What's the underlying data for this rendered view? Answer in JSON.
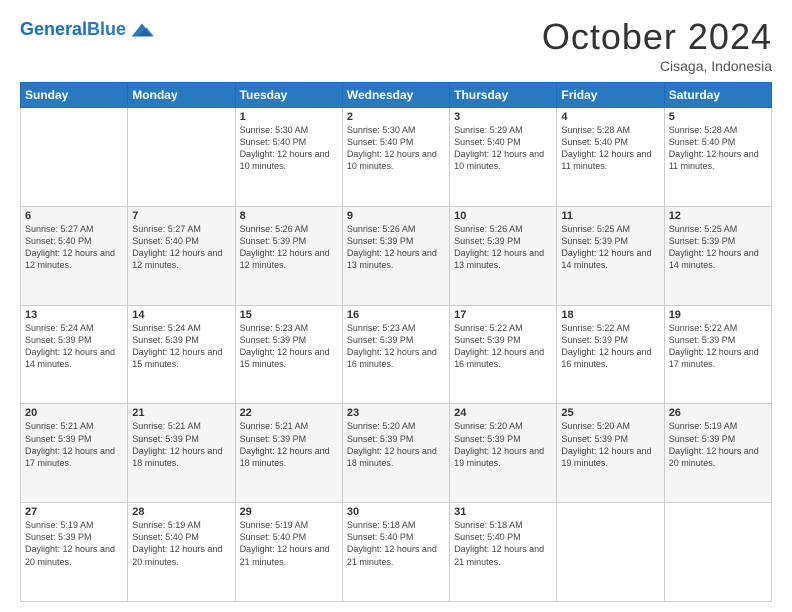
{
  "header": {
    "logo_general": "General",
    "logo_blue": "Blue",
    "month_title": "October 2024",
    "location": "Cisaga, Indonesia"
  },
  "weekdays": [
    "Sunday",
    "Monday",
    "Tuesday",
    "Wednesday",
    "Thursday",
    "Friday",
    "Saturday"
  ],
  "weeks": [
    [
      {
        "day": "",
        "info": ""
      },
      {
        "day": "",
        "info": ""
      },
      {
        "day": "1",
        "info": "Sunrise: 5:30 AM\nSunset: 5:40 PM\nDaylight: 12 hours and 10 minutes."
      },
      {
        "day": "2",
        "info": "Sunrise: 5:30 AM\nSunset: 5:40 PM\nDaylight: 12 hours and 10 minutes."
      },
      {
        "day": "3",
        "info": "Sunrise: 5:29 AM\nSunset: 5:40 PM\nDaylight: 12 hours and 10 minutes."
      },
      {
        "day": "4",
        "info": "Sunrise: 5:28 AM\nSunset: 5:40 PM\nDaylight: 12 hours and 11 minutes."
      },
      {
        "day": "5",
        "info": "Sunrise: 5:28 AM\nSunset: 5:40 PM\nDaylight: 12 hours and 11 minutes."
      }
    ],
    [
      {
        "day": "6",
        "info": "Sunrise: 5:27 AM\nSunset: 5:40 PM\nDaylight: 12 hours and 12 minutes."
      },
      {
        "day": "7",
        "info": "Sunrise: 5:27 AM\nSunset: 5:40 PM\nDaylight: 12 hours and 12 minutes."
      },
      {
        "day": "8",
        "info": "Sunrise: 5:26 AM\nSunset: 5:39 PM\nDaylight: 12 hours and 12 minutes."
      },
      {
        "day": "9",
        "info": "Sunrise: 5:26 AM\nSunset: 5:39 PM\nDaylight: 12 hours and 13 minutes."
      },
      {
        "day": "10",
        "info": "Sunrise: 5:26 AM\nSunset: 5:39 PM\nDaylight: 12 hours and 13 minutes."
      },
      {
        "day": "11",
        "info": "Sunrise: 5:25 AM\nSunset: 5:39 PM\nDaylight: 12 hours and 14 minutes."
      },
      {
        "day": "12",
        "info": "Sunrise: 5:25 AM\nSunset: 5:39 PM\nDaylight: 12 hours and 14 minutes."
      }
    ],
    [
      {
        "day": "13",
        "info": "Sunrise: 5:24 AM\nSunset: 5:39 PM\nDaylight: 12 hours and 14 minutes."
      },
      {
        "day": "14",
        "info": "Sunrise: 5:24 AM\nSunset: 5:39 PM\nDaylight: 12 hours and 15 minutes."
      },
      {
        "day": "15",
        "info": "Sunrise: 5:23 AM\nSunset: 5:39 PM\nDaylight: 12 hours and 15 minutes."
      },
      {
        "day": "16",
        "info": "Sunrise: 5:23 AM\nSunset: 5:39 PM\nDaylight: 12 hours and 16 minutes."
      },
      {
        "day": "17",
        "info": "Sunrise: 5:22 AM\nSunset: 5:39 PM\nDaylight: 12 hours and 16 minutes."
      },
      {
        "day": "18",
        "info": "Sunrise: 5:22 AM\nSunset: 5:39 PM\nDaylight: 12 hours and 16 minutes."
      },
      {
        "day": "19",
        "info": "Sunrise: 5:22 AM\nSunset: 5:39 PM\nDaylight: 12 hours and 17 minutes."
      }
    ],
    [
      {
        "day": "20",
        "info": "Sunrise: 5:21 AM\nSunset: 5:39 PM\nDaylight: 12 hours and 17 minutes."
      },
      {
        "day": "21",
        "info": "Sunrise: 5:21 AM\nSunset: 5:39 PM\nDaylight: 12 hours and 18 minutes."
      },
      {
        "day": "22",
        "info": "Sunrise: 5:21 AM\nSunset: 5:39 PM\nDaylight: 12 hours and 18 minutes."
      },
      {
        "day": "23",
        "info": "Sunrise: 5:20 AM\nSunset: 5:39 PM\nDaylight: 12 hours and 18 minutes."
      },
      {
        "day": "24",
        "info": "Sunrise: 5:20 AM\nSunset: 5:39 PM\nDaylight: 12 hours and 19 minutes."
      },
      {
        "day": "25",
        "info": "Sunrise: 5:20 AM\nSunset: 5:39 PM\nDaylight: 12 hours and 19 minutes."
      },
      {
        "day": "26",
        "info": "Sunrise: 5:19 AM\nSunset: 5:39 PM\nDaylight: 12 hours and 20 minutes."
      }
    ],
    [
      {
        "day": "27",
        "info": "Sunrise: 5:19 AM\nSunset: 5:39 PM\nDaylight: 12 hours and 20 minutes."
      },
      {
        "day": "28",
        "info": "Sunrise: 5:19 AM\nSunset: 5:40 PM\nDaylight: 12 hours and 20 minutes."
      },
      {
        "day": "29",
        "info": "Sunrise: 5:19 AM\nSunset: 5:40 PM\nDaylight: 12 hours and 21 minutes."
      },
      {
        "day": "30",
        "info": "Sunrise: 5:18 AM\nSunset: 5:40 PM\nDaylight: 12 hours and 21 minutes."
      },
      {
        "day": "31",
        "info": "Sunrise: 5:18 AM\nSunset: 5:40 PM\nDaylight: 12 hours and 21 minutes."
      },
      {
        "day": "",
        "info": ""
      },
      {
        "day": "",
        "info": ""
      }
    ]
  ]
}
